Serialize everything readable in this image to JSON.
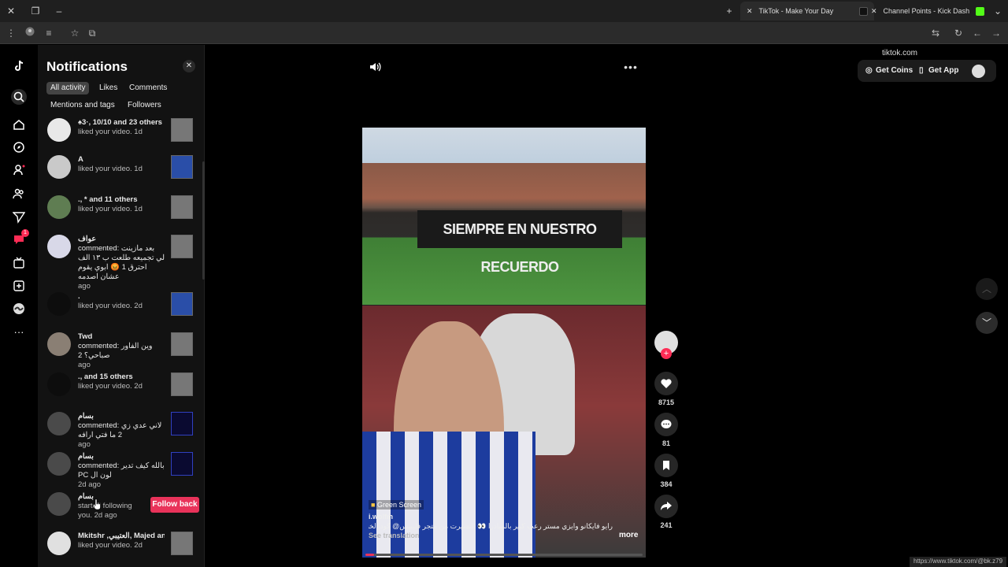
{
  "browser": {
    "tabs": [
      {
        "title": "TikTok - Make Your Day",
        "active": true
      },
      {
        "title": "Channel Points - Kick Dashboa",
        "active": false
      }
    ],
    "url": "tiktok.com",
    "status_url": "https://www.tiktok.com/@bk.z79"
  },
  "notifications": {
    "title": "Notifications",
    "filters": [
      "All activity",
      "Likes",
      "Comments",
      "Mentions and tags",
      "Followers"
    ],
    "selected_filter": "All activity",
    "items": [
      {
        "user": "♠︎3·, 10/10 and 23 others",
        "text": "liked your video. 1d"
      },
      {
        "user": "A",
        "text": "liked your video. 1d"
      },
      {
        "user": "., * and 11 others",
        "text": "liked your video. 1d"
      },
      {
        "user": "ﻋﻮﺍﻑ",
        "text": "commented: بعد مازينت لي تجميعه طلعت ب ١٣ الف احترق 1 😡 ابوي يقوم عشان اصدمه",
        "time": "ago"
      },
      {
        "user": ".",
        "text": "liked your video. 2d"
      },
      {
        "user": "Twd",
        "text": "commented: وين الفاور صباحي؟ 2",
        "time": "ago"
      },
      {
        "user": ".,  and 15 others",
        "text": "liked your video. 2d"
      },
      {
        "user": "بسام",
        "text": "commented: لاني عدي زي 2 ما فتي ارافه",
        "time": "ago"
      },
      {
        "user": "بسام",
        "text": "commented: بالله كيف تدير PC لون ال",
        "time": "2d ago"
      },
      {
        "user": "بسام",
        "text": "started following you. 2d ago",
        "follow_back": "Follow back"
      },
      {
        "user": "Mkitshr ,العتيبي, Majed an...",
        "text": "liked your video. 2d"
      }
    ]
  },
  "header": {
    "get_coins": "Get Coins",
    "get_app": "Get App"
  },
  "video": {
    "banner_text": "SIEMPRE EN NUESTRO RECUERDO",
    "effect": "Green Screen",
    "author": "i.wolfm",
    "caption": "رايو فايكانو وايزي مستر رعب كبير بالمبادرا 👀 التشيرت من متجر فليبيس@ كود الخصم M27 ...",
    "see_translation": "See translation",
    "more": "more",
    "progress": 0.03
  },
  "actions": {
    "likes": "8715",
    "comments": "81",
    "saves": "384",
    "shares": "241"
  },
  "nav_badge": "1"
}
